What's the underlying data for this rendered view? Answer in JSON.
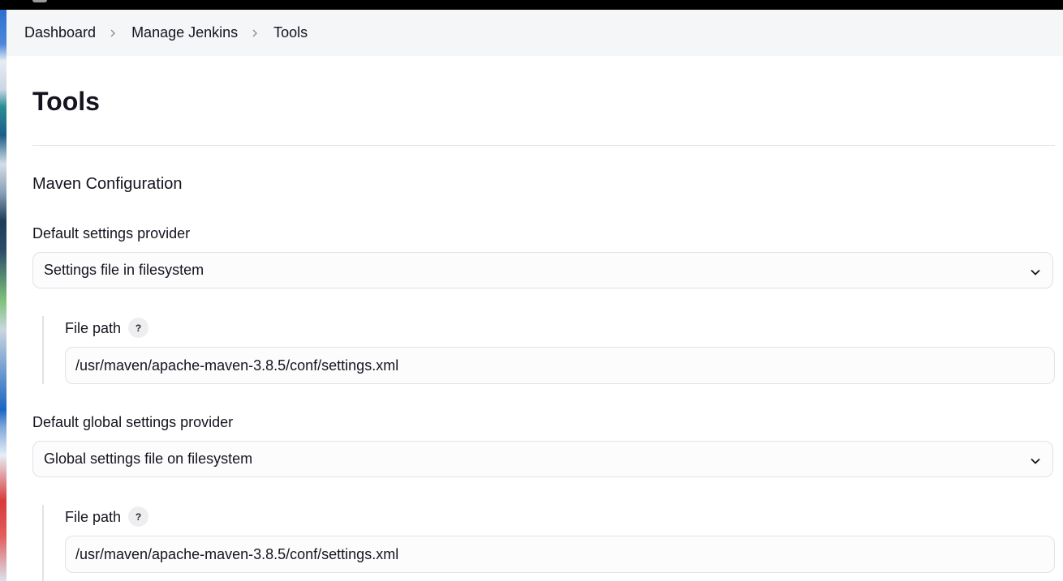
{
  "breadcrumb": [
    {
      "label": "Dashboard"
    },
    {
      "label": "Manage Jenkins"
    },
    {
      "label": "Tools"
    }
  ],
  "page_title": "Tools",
  "maven": {
    "section_title": "Maven Configuration",
    "default_settings": {
      "label": "Default settings provider",
      "selected": "Settings file in filesystem",
      "file_path_label": "File path",
      "help": "?",
      "file_path_value": "/usr/maven/apache-maven-3.8.5/conf/settings.xml"
    },
    "global_settings": {
      "label": "Default global settings provider",
      "selected": "Global settings file on filesystem",
      "file_path_label": "File path",
      "help": "?",
      "file_path_value": "/usr/maven/apache-maven-3.8.5/conf/settings.xml"
    }
  },
  "icons": {
    "breadcrumb_separator": "chevron-right-icon",
    "select_arrow": "chevron-down-icon"
  },
  "colors": {
    "breadcrumb_bg": "#f5f6f8",
    "top_bar": "#000000",
    "text": "#14141f",
    "field_border": "#e2e2e6"
  }
}
